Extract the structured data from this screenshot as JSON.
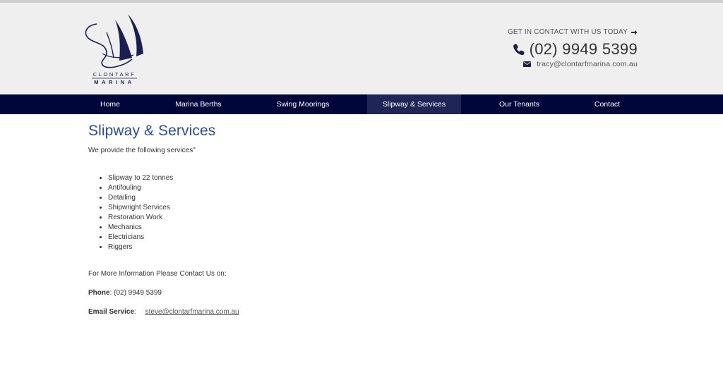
{
  "header": {
    "logo": {
      "line1": "CLONTARF",
      "line2": "MARINA"
    },
    "cta_label": "GET IN CONTACT WITH US TODAY",
    "phone": "(02) 9949 5399",
    "email": "tracy@clontarfmarina.com.au"
  },
  "nav": {
    "items": [
      {
        "label": "Home"
      },
      {
        "label": "Marina Berths"
      },
      {
        "label": "Swing Moorings"
      },
      {
        "label": "Slipway & Services",
        "active": true
      },
      {
        "label": "Our Tenants"
      },
      {
        "label": "Contact"
      }
    ]
  },
  "content": {
    "title": "Slipway & Services",
    "intro": "We provide the following services\"",
    "services": [
      "Slipway to 22 tonnes",
      "Antifouling",
      "Detailing",
      "Shipwright Services",
      "Restoration Work",
      "Mechanics",
      "Electricians",
      "Riggers"
    ],
    "more_info": "For More Information Please Contact Us on:",
    "phone_label": "Phone",
    "phone_value": ": (02) 9949 5399",
    "email_label": "Email Service",
    "email_colon": ":",
    "email_value": "steve@clontarfmarina.com.au"
  },
  "colors": {
    "nav_bg": "#00053a",
    "nav_active_bg": "#1f2557",
    "title": "#2f4c9b",
    "header_bg": "#efefef"
  },
  "icons": [
    "logo-sail-icon",
    "arrow-right-icon",
    "phone-icon",
    "envelope-icon"
  ]
}
